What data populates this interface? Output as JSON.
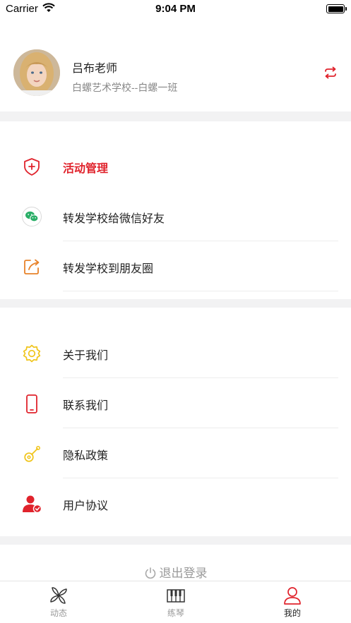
{
  "status_bar": {
    "carrier": "Carrier",
    "time": "9:04 PM"
  },
  "profile": {
    "name": "吕布老师",
    "school": "白螺艺术学校--白螺一班",
    "switch_icon": "switch-icon"
  },
  "menu_group_1": [
    {
      "label": "活动管理",
      "icon": "shield-plus-icon",
      "highlight": true
    },
    {
      "label": "转发学校给微信好友",
      "icon": "wechat-icon"
    },
    {
      "label": "转发学校到朋友圈",
      "icon": "share-icon"
    }
  ],
  "menu_group_2": [
    {
      "label": "关于我们",
      "icon": "gear-icon"
    },
    {
      "label": "联系我们",
      "icon": "phone-icon"
    },
    {
      "label": "隐私政策",
      "icon": "key-icon"
    },
    {
      "label": "用户协议",
      "icon": "user-check-icon"
    }
  ],
  "logout": {
    "label": "退出登录"
  },
  "tabbar": [
    {
      "label": "动态",
      "icon": "pinwheel-icon",
      "active": false
    },
    {
      "label": "练琴",
      "icon": "piano-icon",
      "active": false
    },
    {
      "label": "我的",
      "icon": "profile-icon",
      "active": true
    }
  ],
  "colors": {
    "accent": "#e0232c",
    "muted": "#9a9a9a",
    "divider": "#f2f2f3"
  }
}
